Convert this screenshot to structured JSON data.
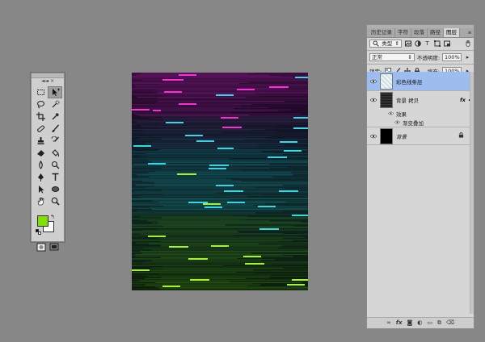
{
  "tools_panel": {
    "collapse_glyph": "◄◄",
    "close_glyph": "×",
    "fg_color": "#7ee100",
    "bg_color": "#ffffff"
  },
  "layers_panel": {
    "tabs": [
      "历史记录",
      "字符",
      "段落",
      "路径",
      "图层"
    ],
    "active_tab": "图层",
    "filter_label": "类型",
    "blend_mode": "正常",
    "opacity_label": "不透明度:",
    "opacity_value": "100%",
    "lock_label": "锁定:",
    "fill_label": "填充:",
    "fill_value": "100%",
    "layers": [
      {
        "name": "彩色线条层",
        "selected": true
      },
      {
        "name": "背景 拷贝",
        "fx": "fx",
        "effects_label": "效果",
        "effect_item": "渐变叠加"
      },
      {
        "name": "背景"
      }
    ]
  },
  "colors": {
    "workspace": "#878787",
    "selection": "#9dbcef",
    "magenta": "#ff2bd6",
    "cyan": "#32d8e8",
    "lime": "#a8f22a"
  }
}
